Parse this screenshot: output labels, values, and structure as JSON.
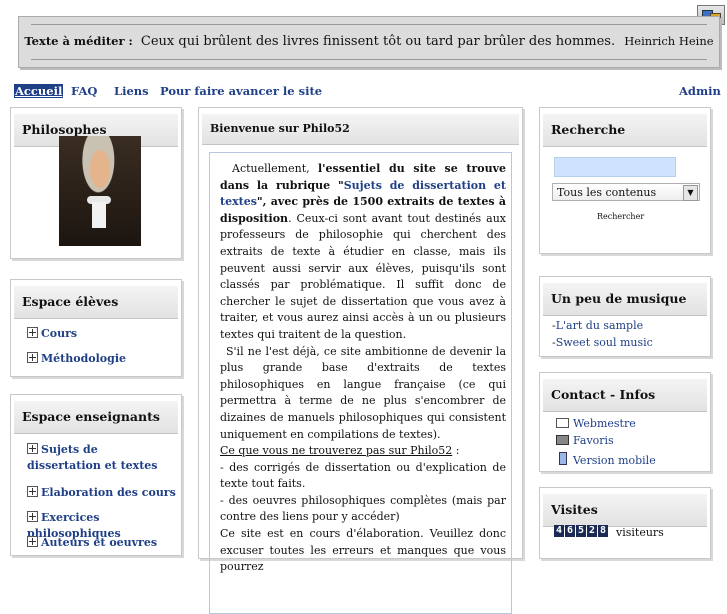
{
  "quote": {
    "label": "Texte à méditer :",
    "text": "Ceux qui brûlent des livres finissent tôt ou tard par brûler des hommes.",
    "author": "Heinrich Heine"
  },
  "nav": {
    "items": [
      "Accueil",
      "FAQ",
      "Liens",
      "Pour faire avancer le site"
    ],
    "admin": "Admin"
  },
  "philosophes": {
    "title": "Philosophes"
  },
  "eleves": {
    "title": "Espace élèves",
    "items": [
      "Cours",
      "Méthodologie"
    ]
  },
  "enseignants": {
    "title": "Espace enseignants",
    "items": [
      "Sujets de dissertation et textes",
      "Elaboration des cours",
      "Exercices philosophiques",
      "Auteurs et oeuvres"
    ]
  },
  "main": {
    "title": "Bienvenue sur Philo52",
    "p1_a": "Actuellement, ",
    "p1_b": "l'essentiel du site se trouve dans la rubrique \"",
    "p1_link": "Sujets de dissertation et textes",
    "p1_c": "\", avec près de 1500 extraits de textes à disposition",
    "p1_d": ". Ceux-ci sont avant tout destinés aux professeurs de philosophie qui cherchent des extraits de texte à étudier en classe, mais ils peuvent aussi servir aux élèves, puisqu'ils sont classés par problématique. Il suffit donc de chercher le sujet de dissertation que vous avez à traiter, et vous aurez ainsi accès à un ou plusieurs textes qui traitent de la question.",
    "p2": "S'il ne l'est déjà, ce site ambitionne de devenir la plus grande base d'extraits de textes philosophiques en langue française (ce qui permettra à terme de ne plus s'encombrer de dizaines de manuels philosophiques qui consistent uniquement en compilations de textes).",
    "u": "Ce que vous ne trouverez pas sur Philo52",
    "u_after": " :",
    "l1": "- des corrigés de dissertation ou d'explication de texte tout faits.",
    "l2": "- des oeuvres philosophiques complètes (mais par contre des liens pour y accéder)",
    "p3": "Ce site est en cours d'élaboration. Veuillez donc excuser toutes les erreurs et manques que vous pourrez"
  },
  "recherche": {
    "title": "Recherche",
    "select_value": "Tous les contenus",
    "button": "Rechercher"
  },
  "musique": {
    "title": "Un peu de musique",
    "items": [
      "L'art du sample",
      "Sweet soul music"
    ]
  },
  "contact": {
    "title": "Contact - Infos",
    "items": [
      "Webmestre",
      "Favoris",
      "Version mobile"
    ]
  },
  "visites": {
    "title": "Visites",
    "digits": [
      "4",
      "6",
      "5",
      "2",
      "8"
    ],
    "label": "visiteurs"
  },
  "colors": {
    "link": "#1f3f86",
    "header_bg": "#e8e8e8",
    "quote_bg": "#dcdcdc"
  }
}
